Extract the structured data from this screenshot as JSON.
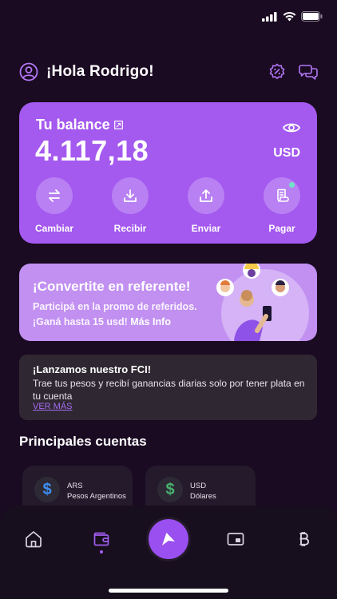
{
  "header": {
    "greeting": "¡Hola Rodrigo!"
  },
  "balance": {
    "label": "Tu balance",
    "amount": "4.117,18",
    "currency": "USD",
    "actions": [
      {
        "label": "Cambiar",
        "icon": "swap-icon"
      },
      {
        "label": "Recibir",
        "icon": "download-icon"
      },
      {
        "label": "Enviar",
        "icon": "upload-icon"
      },
      {
        "label": "Pagar",
        "icon": "receipt-icon"
      }
    ]
  },
  "promo": {
    "title": "¡Convertite en referente!",
    "line1": "Participá en la promo de referidos.",
    "line2_prefix": "¡Ganá hasta 15 usd! ",
    "line2_link": "Más Info"
  },
  "news": {
    "title": "¡Lanzamos nuestro FCI!",
    "description": "Trae tus pesos y recibí ganancias diarias solo por tener plata en tu cuenta",
    "link": "VER MÁS"
  },
  "accounts": {
    "title": "Principales cuentas",
    "items": [
      {
        "code": "ARS",
        "name": "Pesos Argentinos",
        "symbol": "$",
        "color": "#3f8ef0"
      },
      {
        "code": "USD",
        "name": "Dólares",
        "symbol": "$",
        "color": "#47b26d"
      }
    ]
  },
  "tabs": [
    "home-icon",
    "wallet-icon",
    "send-icon",
    "card-icon",
    "bitcoin-icon"
  ],
  "colors": {
    "background": "#1a0a22",
    "accent": "#a459ef",
    "promo": "#c190f1"
  }
}
